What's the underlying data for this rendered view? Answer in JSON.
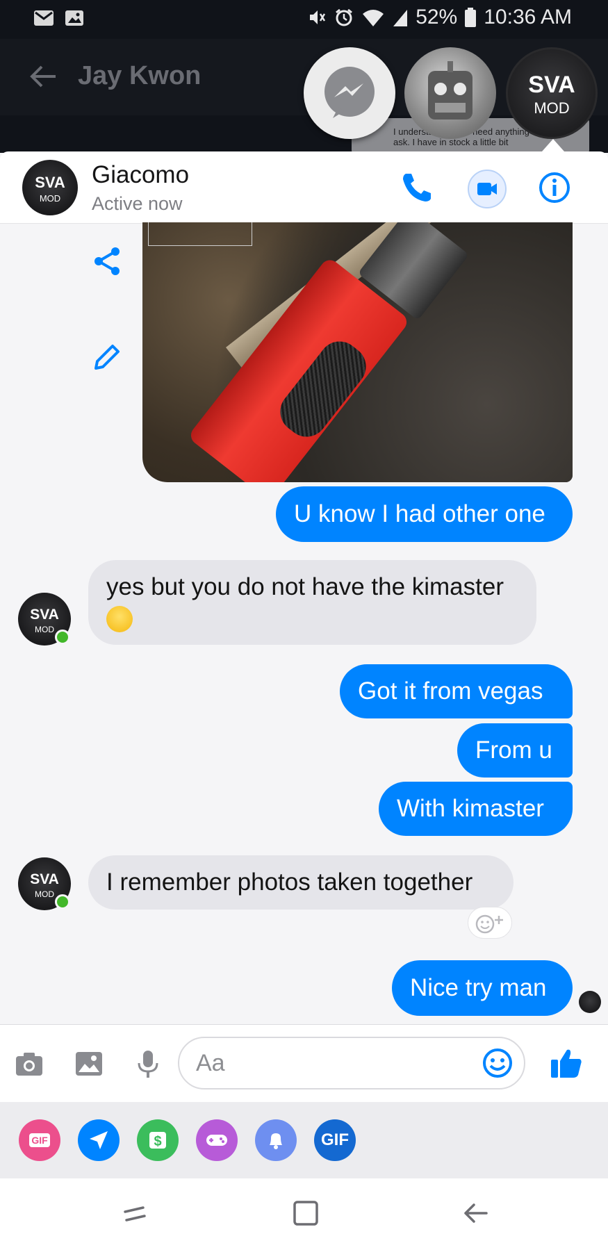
{
  "status_bar": {
    "battery": "52%",
    "time": "10:36 AM"
  },
  "background_chat": {
    "title": "Jay Kwon",
    "preview_text": "I understand, if you need anything else ask. I have in stock a little bit"
  },
  "chat_heads": {
    "brand_text": "SVA",
    "brand_sub": "MOD"
  },
  "header": {
    "contact_name": "Giacomo",
    "status": "Active now"
  },
  "messages": [
    {
      "from": "me",
      "text": "U know I had other one"
    },
    {
      "from": "them",
      "text": "yes but you do not have the kimaster"
    },
    {
      "from": "me",
      "text": "Got it from vegas"
    },
    {
      "from": "me",
      "text": "From u"
    },
    {
      "from": "me",
      "text": "With kimaster"
    },
    {
      "from": "them",
      "text": "I remember photos taken together"
    },
    {
      "from": "me",
      "text": "Nice try man"
    }
  ],
  "composer": {
    "placeholder": "Aa"
  },
  "tray": {
    "gif_label": "GIF",
    "gif2_label": "GIF"
  },
  "colors": {
    "accent": "#0084ff",
    "online": "#42b72a",
    "incoming_bubble": "#e5e5ea"
  },
  "icons": [
    "camera-icon",
    "gallery-icon",
    "microphone-icon",
    "emoji-icon",
    "thumbs-up-icon",
    "share-icon",
    "edit-icon",
    "phone-icon",
    "video-icon",
    "info-icon"
  ]
}
